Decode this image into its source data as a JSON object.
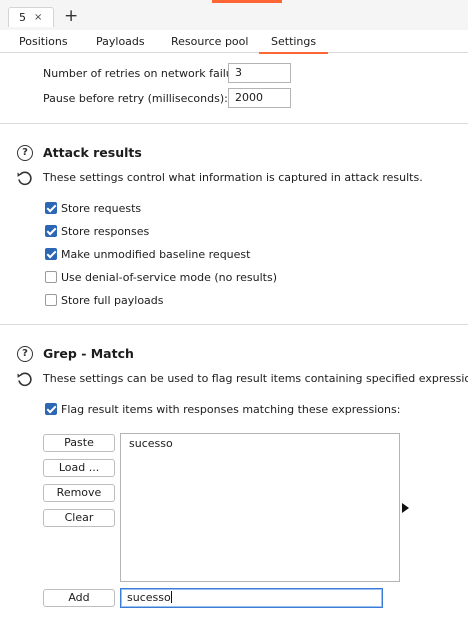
{
  "tab_bar": {
    "number_tab": "5",
    "close_glyph": "×",
    "new_tab_glyph": "+"
  },
  "subtabs": [
    "Positions",
    "Payloads",
    "Resource pool",
    "Settings"
  ],
  "active_subtab": "Settings",
  "retries": {
    "retries_label": "Number of retries on network failure:",
    "retries_value": "3",
    "pause_label": "Pause before retry (milliseconds):",
    "pause_value": "2000"
  },
  "attack_results": {
    "title": "Attack results",
    "description": "These settings control what information is captured in attack results.",
    "options": [
      {
        "label": "Store requests",
        "checked": true
      },
      {
        "label": "Store responses",
        "checked": true
      },
      {
        "label": "Make unmodified baseline request",
        "checked": true
      },
      {
        "label": "Use denial-of-service mode (no results)",
        "checked": false
      },
      {
        "label": "Store full payloads",
        "checked": false
      }
    ]
  },
  "grep_match": {
    "title": "Grep - Match",
    "description": "These settings can be used to flag result items containing specified expressions.",
    "flag_label": "Flag result items with responses matching these expressions:",
    "flag_checked": true,
    "buttons": {
      "paste": "Paste",
      "load": "Load ...",
      "remove": "Remove",
      "clear": "Clear",
      "add": "Add"
    },
    "items": [
      "sucesso"
    ],
    "add_value": "sucesso"
  },
  "icons": {
    "help": "help-circle-icon",
    "reset": "reset-icon",
    "expand": "expand-arrow-icon"
  },
  "colors": {
    "accent": "#ff6633",
    "checkbox": "#2b67b5",
    "focus": "#3a7bd5"
  }
}
